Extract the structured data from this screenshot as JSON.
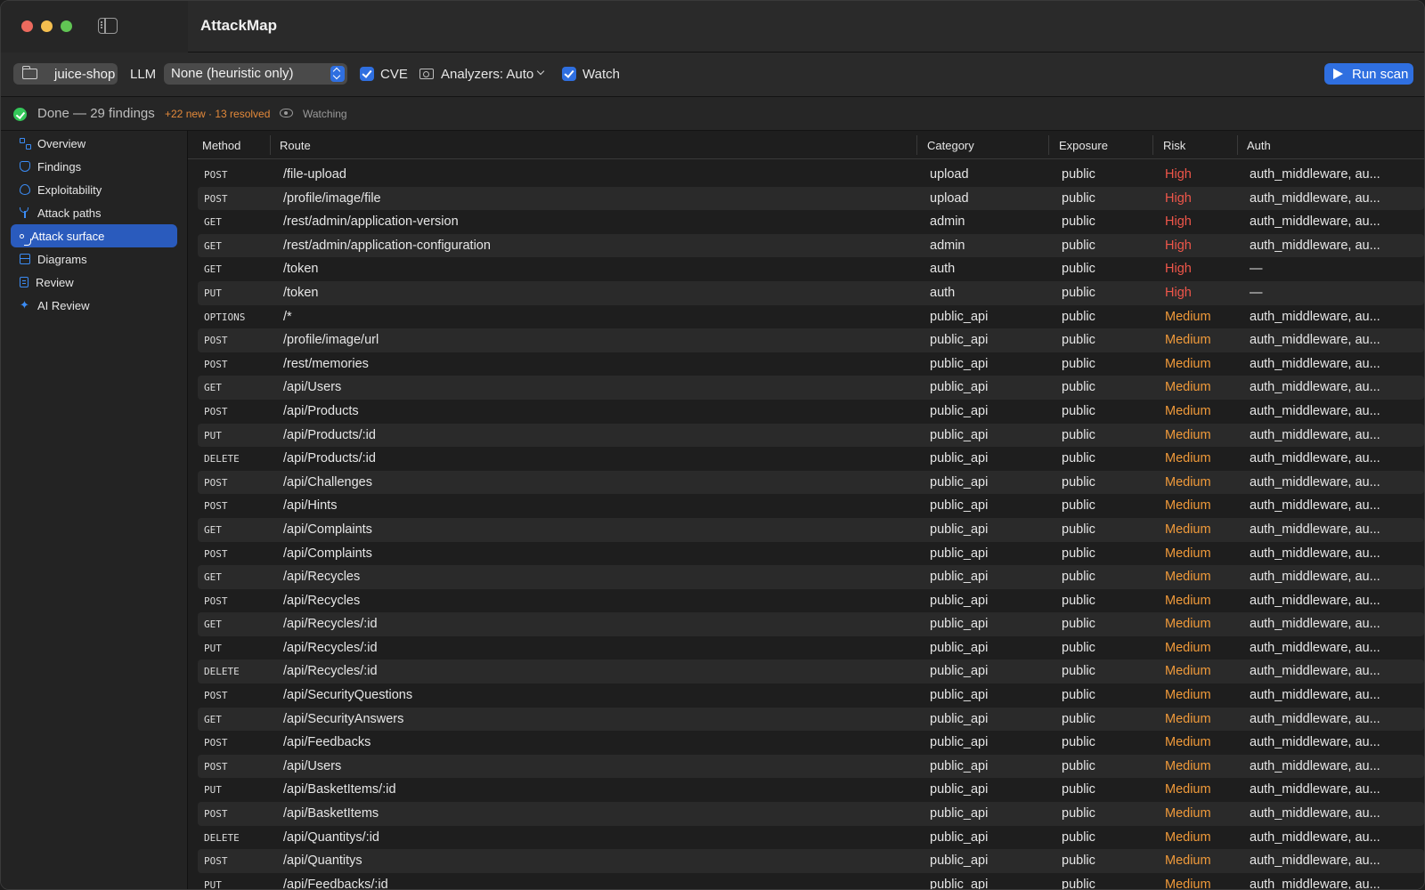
{
  "app": {
    "title": "AttackMap"
  },
  "toolbar": {
    "project": "juice-shop",
    "llm_label": "LLM",
    "llm_value": "None (heuristic only)",
    "cve_label": "CVE",
    "analyzers_label": "Analyzers: Auto",
    "watch_label": "Watch",
    "run_label": "Run scan"
  },
  "status": {
    "text": "Done — 29 findings",
    "delta": "+22 new · 13 resolved",
    "watching": "Watching"
  },
  "sidebar": {
    "items": [
      {
        "label": "Overview",
        "icon": "grid-icon"
      },
      {
        "label": "Findings",
        "icon": "shield-icon"
      },
      {
        "label": "Exploitability",
        "icon": "flame-icon"
      },
      {
        "label": "Attack paths",
        "icon": "branch-icon"
      },
      {
        "label": "Attack surface",
        "icon": "path-icon",
        "active": true
      },
      {
        "label": "Diagrams",
        "icon": "diagram-icon"
      },
      {
        "label": "Review",
        "icon": "document-icon"
      },
      {
        "label": "AI Review",
        "icon": "sparkle-icon"
      }
    ]
  },
  "table": {
    "columns": [
      "Method",
      "Route",
      "Category",
      "Exposure",
      "Risk",
      "Auth"
    ],
    "rows": [
      {
        "method": "POST",
        "route": "/file-upload",
        "category": "upload",
        "exposure": "public",
        "risk": "High",
        "auth": "auth_middleware, au..."
      },
      {
        "method": "POST",
        "route": "/profile/image/file",
        "category": "upload",
        "exposure": "public",
        "risk": "High",
        "auth": "auth_middleware, au..."
      },
      {
        "method": "GET",
        "route": "/rest/admin/application-version",
        "category": "admin",
        "exposure": "public",
        "risk": "High",
        "auth": "auth_middleware, au..."
      },
      {
        "method": "GET",
        "route": "/rest/admin/application-configuration",
        "category": "admin",
        "exposure": "public",
        "risk": "High",
        "auth": "auth_middleware, au..."
      },
      {
        "method": "GET",
        "route": "/token",
        "category": "auth",
        "exposure": "public",
        "risk": "High",
        "auth": "—"
      },
      {
        "method": "PUT",
        "route": "/token",
        "category": "auth",
        "exposure": "public",
        "risk": "High",
        "auth": "—"
      },
      {
        "method": "OPTIONS",
        "route": "/*",
        "category": "public_api",
        "exposure": "public",
        "risk": "Medium",
        "auth": "auth_middleware, au..."
      },
      {
        "method": "POST",
        "route": "/profile/image/url",
        "category": "public_api",
        "exposure": "public",
        "risk": "Medium",
        "auth": "auth_middleware, au..."
      },
      {
        "method": "POST",
        "route": "/rest/memories",
        "category": "public_api",
        "exposure": "public",
        "risk": "Medium",
        "auth": "auth_middleware, au..."
      },
      {
        "method": "GET",
        "route": "/api/Users",
        "category": "public_api",
        "exposure": "public",
        "risk": "Medium",
        "auth": "auth_middleware, au..."
      },
      {
        "method": "POST",
        "route": "/api/Products",
        "category": "public_api",
        "exposure": "public",
        "risk": "Medium",
        "auth": "auth_middleware, au..."
      },
      {
        "method": "PUT",
        "route": "/api/Products/:id",
        "category": "public_api",
        "exposure": "public",
        "risk": "Medium",
        "auth": "auth_middleware, au..."
      },
      {
        "method": "DELETE",
        "route": "/api/Products/:id",
        "category": "public_api",
        "exposure": "public",
        "risk": "Medium",
        "auth": "auth_middleware, au..."
      },
      {
        "method": "POST",
        "route": "/api/Challenges",
        "category": "public_api",
        "exposure": "public",
        "risk": "Medium",
        "auth": "auth_middleware, au..."
      },
      {
        "method": "POST",
        "route": "/api/Hints",
        "category": "public_api",
        "exposure": "public",
        "risk": "Medium",
        "auth": "auth_middleware, au..."
      },
      {
        "method": "GET",
        "route": "/api/Complaints",
        "category": "public_api",
        "exposure": "public",
        "risk": "Medium",
        "auth": "auth_middleware, au..."
      },
      {
        "method": "POST",
        "route": "/api/Complaints",
        "category": "public_api",
        "exposure": "public",
        "risk": "Medium",
        "auth": "auth_middleware, au..."
      },
      {
        "method": "GET",
        "route": "/api/Recycles",
        "category": "public_api",
        "exposure": "public",
        "risk": "Medium",
        "auth": "auth_middleware, au..."
      },
      {
        "method": "POST",
        "route": "/api/Recycles",
        "category": "public_api",
        "exposure": "public",
        "risk": "Medium",
        "auth": "auth_middleware, au..."
      },
      {
        "method": "GET",
        "route": "/api/Recycles/:id",
        "category": "public_api",
        "exposure": "public",
        "risk": "Medium",
        "auth": "auth_middleware, au..."
      },
      {
        "method": "PUT",
        "route": "/api/Recycles/:id",
        "category": "public_api",
        "exposure": "public",
        "risk": "Medium",
        "auth": "auth_middleware, au..."
      },
      {
        "method": "DELETE",
        "route": "/api/Recycles/:id",
        "category": "public_api",
        "exposure": "public",
        "risk": "Medium",
        "auth": "auth_middleware, au..."
      },
      {
        "method": "POST",
        "route": "/api/SecurityQuestions",
        "category": "public_api",
        "exposure": "public",
        "risk": "Medium",
        "auth": "auth_middleware, au..."
      },
      {
        "method": "GET",
        "route": "/api/SecurityAnswers",
        "category": "public_api",
        "exposure": "public",
        "risk": "Medium",
        "auth": "auth_middleware, au..."
      },
      {
        "method": "POST",
        "route": "/api/Feedbacks",
        "category": "public_api",
        "exposure": "public",
        "risk": "Medium",
        "auth": "auth_middleware, au..."
      },
      {
        "method": "POST",
        "route": "/api/Users",
        "category": "public_api",
        "exposure": "public",
        "risk": "Medium",
        "auth": "auth_middleware, au..."
      },
      {
        "method": "PUT",
        "route": "/api/BasketItems/:id",
        "category": "public_api",
        "exposure": "public",
        "risk": "Medium",
        "auth": "auth_middleware, au..."
      },
      {
        "method": "POST",
        "route": "/api/BasketItems",
        "category": "public_api",
        "exposure": "public",
        "risk": "Medium",
        "auth": "auth_middleware, au..."
      },
      {
        "method": "DELETE",
        "route": "/api/Quantitys/:id",
        "category": "public_api",
        "exposure": "public",
        "risk": "Medium",
        "auth": "auth_middleware, au..."
      },
      {
        "method": "POST",
        "route": "/api/Quantitys",
        "category": "public_api",
        "exposure": "public",
        "risk": "Medium",
        "auth": "auth_middleware, au..."
      },
      {
        "method": "PUT",
        "route": "/api/Feedbacks/:id",
        "category": "public_api",
        "exposure": "public",
        "risk": "Medium",
        "auth": "auth_middleware, au..."
      }
    ]
  },
  "colors": {
    "accent": "#2f6fe0",
    "risk_high": "#f0564a",
    "risk_medium": "#f09a3a",
    "status_ok": "#34c759",
    "delta": "#e3893a"
  }
}
